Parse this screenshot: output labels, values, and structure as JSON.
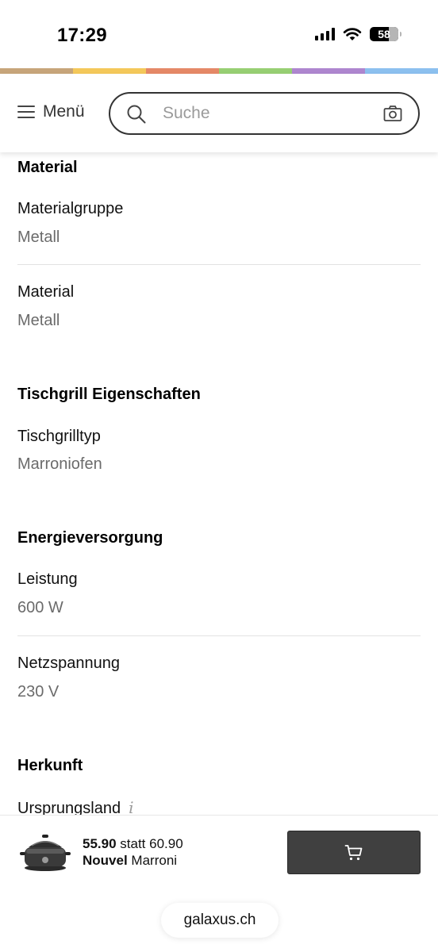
{
  "status": {
    "time": "17:29",
    "battery": "58"
  },
  "stripe_colors": [
    "#c7a57a",
    "#f4c85a",
    "#e58867",
    "#97cf73",
    "#ae86cf",
    "#8cc0ef"
  ],
  "header": {
    "menu_label": "Menü",
    "search_placeholder": "Suche"
  },
  "sections": {
    "material": {
      "title": "Material",
      "props": [
        {
          "label": "Materialgruppe",
          "value": "Metall"
        },
        {
          "label": "Material",
          "value": "Metall"
        }
      ]
    },
    "tischgrill": {
      "title": "Tischgrill Eigenschaften",
      "props": [
        {
          "label": "Tischgrilltyp",
          "value": "Marroniofen"
        }
      ]
    },
    "energie": {
      "title": "Energieversorgung",
      "props": [
        {
          "label": "Leistung",
          "value": "600 W"
        },
        {
          "label": "Netzspannung",
          "value": "230 V"
        }
      ]
    },
    "herkunft": {
      "title": "Herkunft",
      "props": [
        {
          "label": "Ursprungsland",
          "value": ""
        }
      ]
    }
  },
  "buy_bar": {
    "price": "55.90",
    "statt_text": "statt 60.90",
    "brand": "Nouvel",
    "product_name": "Marroni"
  },
  "browser": {
    "url": "galaxus.ch"
  }
}
